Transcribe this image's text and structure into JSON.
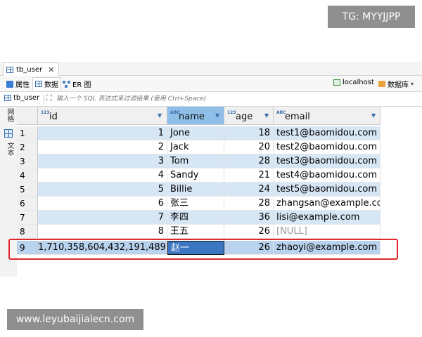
{
  "watermarks": {
    "top": "TG: MYYJJPP",
    "bottom": "www.leyubaijialecn.com"
  },
  "editor_tab": {
    "title": "tb_user",
    "close": "✕"
  },
  "sub_toolbar": {
    "tabs": [
      {
        "label": "属性",
        "icon": "properties-icon"
      },
      {
        "label": "数据",
        "icon": "data-grid-icon"
      },
      {
        "label": "ER 图",
        "icon": "er-diagram-icon"
      }
    ],
    "connection": "localhost",
    "database": "数据库",
    "more": "▾"
  },
  "filter_bar": {
    "table_name": "tb_user",
    "placeholder": "输入一个 SQL 表达式来过滤结果 (使用 Ctrl+Space)"
  },
  "left_strip": {
    "grid_tab": "网格",
    "text_tab": "文本"
  },
  "grid": {
    "columns": [
      {
        "type": "123",
        "name": "id"
      },
      {
        "type": "ABC",
        "name": "name"
      },
      {
        "type": "123",
        "name": "age"
      },
      {
        "type": "ABC",
        "name": "email"
      }
    ],
    "rows": [
      {
        "rn": "1",
        "id": "1",
        "name": "Jone",
        "age": "18",
        "email": "test1@baomidou.com"
      },
      {
        "rn": "2",
        "id": "2",
        "name": "Jack",
        "age": "20",
        "email": "test2@baomidou.com"
      },
      {
        "rn": "3",
        "id": "3",
        "name": "Tom",
        "age": "28",
        "email": "test3@baomidou.com"
      },
      {
        "rn": "4",
        "id": "4",
        "name": "Sandy",
        "age": "21",
        "email": "test4@baomidou.com"
      },
      {
        "rn": "5",
        "id": "5",
        "name": "Billie",
        "age": "24",
        "email": "test5@baomidou.com"
      },
      {
        "rn": "6",
        "id": "6",
        "name": "张三",
        "age": "28",
        "email": "zhangsan@example.com"
      },
      {
        "rn": "7",
        "id": "7",
        "name": "李四",
        "age": "36",
        "email": "lisi@example.com"
      },
      {
        "rn": "8",
        "id": "8",
        "name": "王五",
        "age": "26",
        "email": "[NULL]"
      },
      {
        "rn": "9",
        "id": "1,710,358,604,432,191,489",
        "name": "赵一",
        "age": "26",
        "email": "zhaoyi@example.com"
      }
    ]
  },
  "colors": {
    "selected_header": "#8fbfe8",
    "alt_row": "#d6e6f5",
    "highlight_box": "#e0282c",
    "focused_cell": "#3b76c2"
  }
}
